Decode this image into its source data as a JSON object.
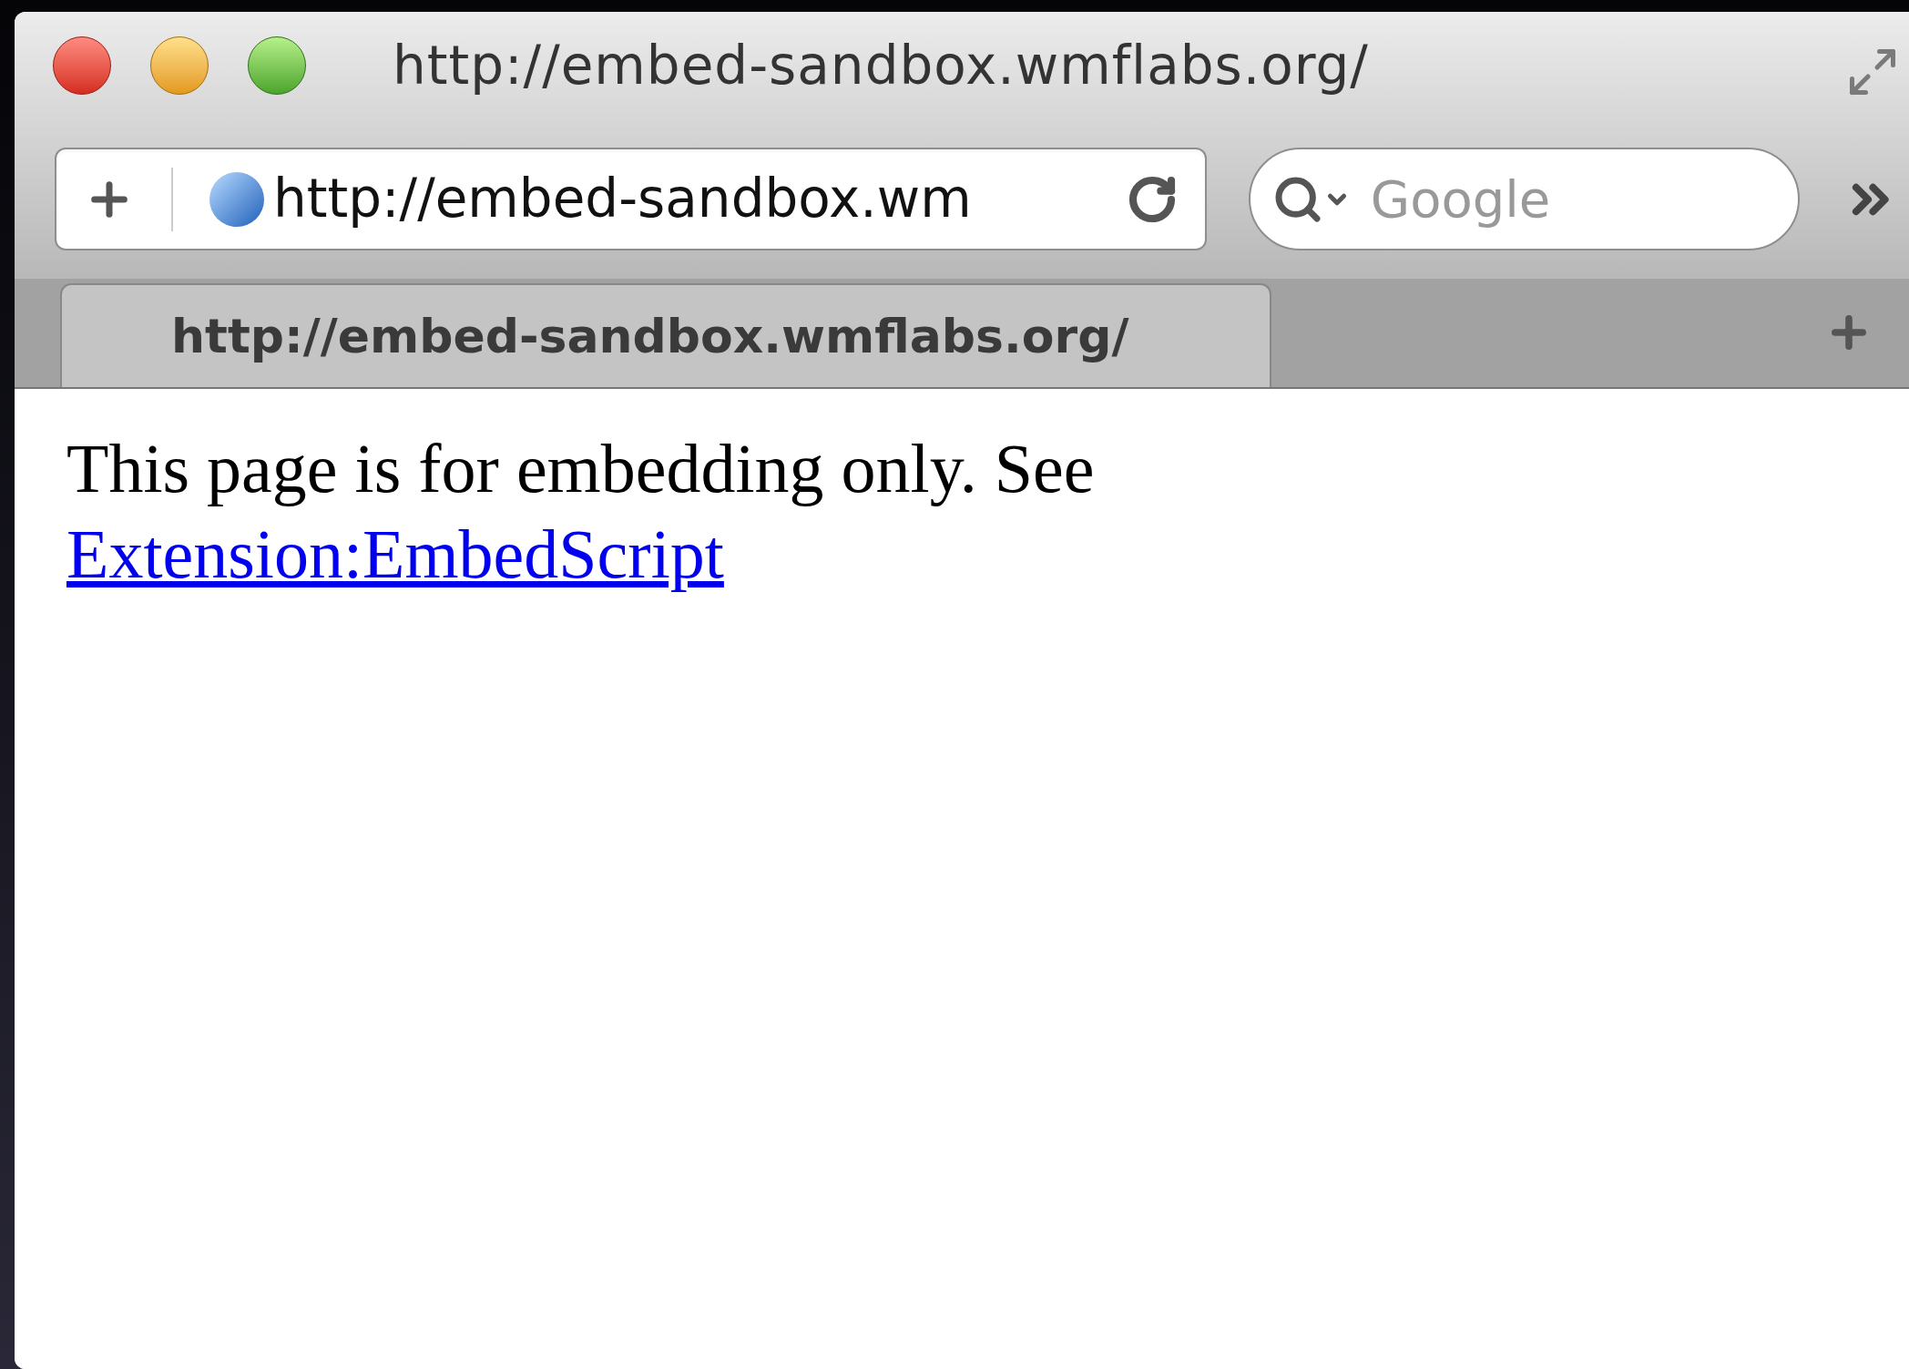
{
  "window": {
    "title": "http://embed-sandbox.wmflabs.org/"
  },
  "toolbar": {
    "address": "http://embed-sandbox.wm",
    "search": {
      "placeholder": "Google"
    }
  },
  "tabs": [
    {
      "label": "http://embed-sandbox.wmflabs.org/",
      "selected": true
    }
  ],
  "page": {
    "text": "This page is for embedding only. See",
    "link": "Extension:EmbedScript"
  }
}
